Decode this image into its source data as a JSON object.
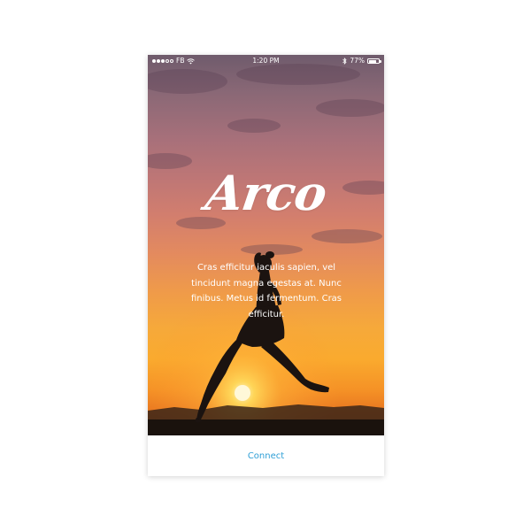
{
  "status_bar": {
    "carrier": "FB",
    "time": "1:20 PM",
    "battery_percent": "77%",
    "battery_level": 0.77,
    "signal_bars_filled": 3,
    "signal_bars_total": 5,
    "icons": [
      "signal-dots-icon",
      "wifi-icon",
      "bluetooth-icon",
      "battery-icon"
    ]
  },
  "hero": {
    "title": "Arco",
    "description": "Cras efficitur iaculis sapien, vel tincidunt magna egestas at. Nunc finibus. Metus id fermentum. Cras efficitur."
  },
  "footer": {
    "connect_label": "Connect"
  },
  "colors": {
    "accent": "#2f9fd6",
    "text_on_image": "#ffffff",
    "sunset_orange": "#f6a93a",
    "sky_purple": "#6f5b6c"
  }
}
